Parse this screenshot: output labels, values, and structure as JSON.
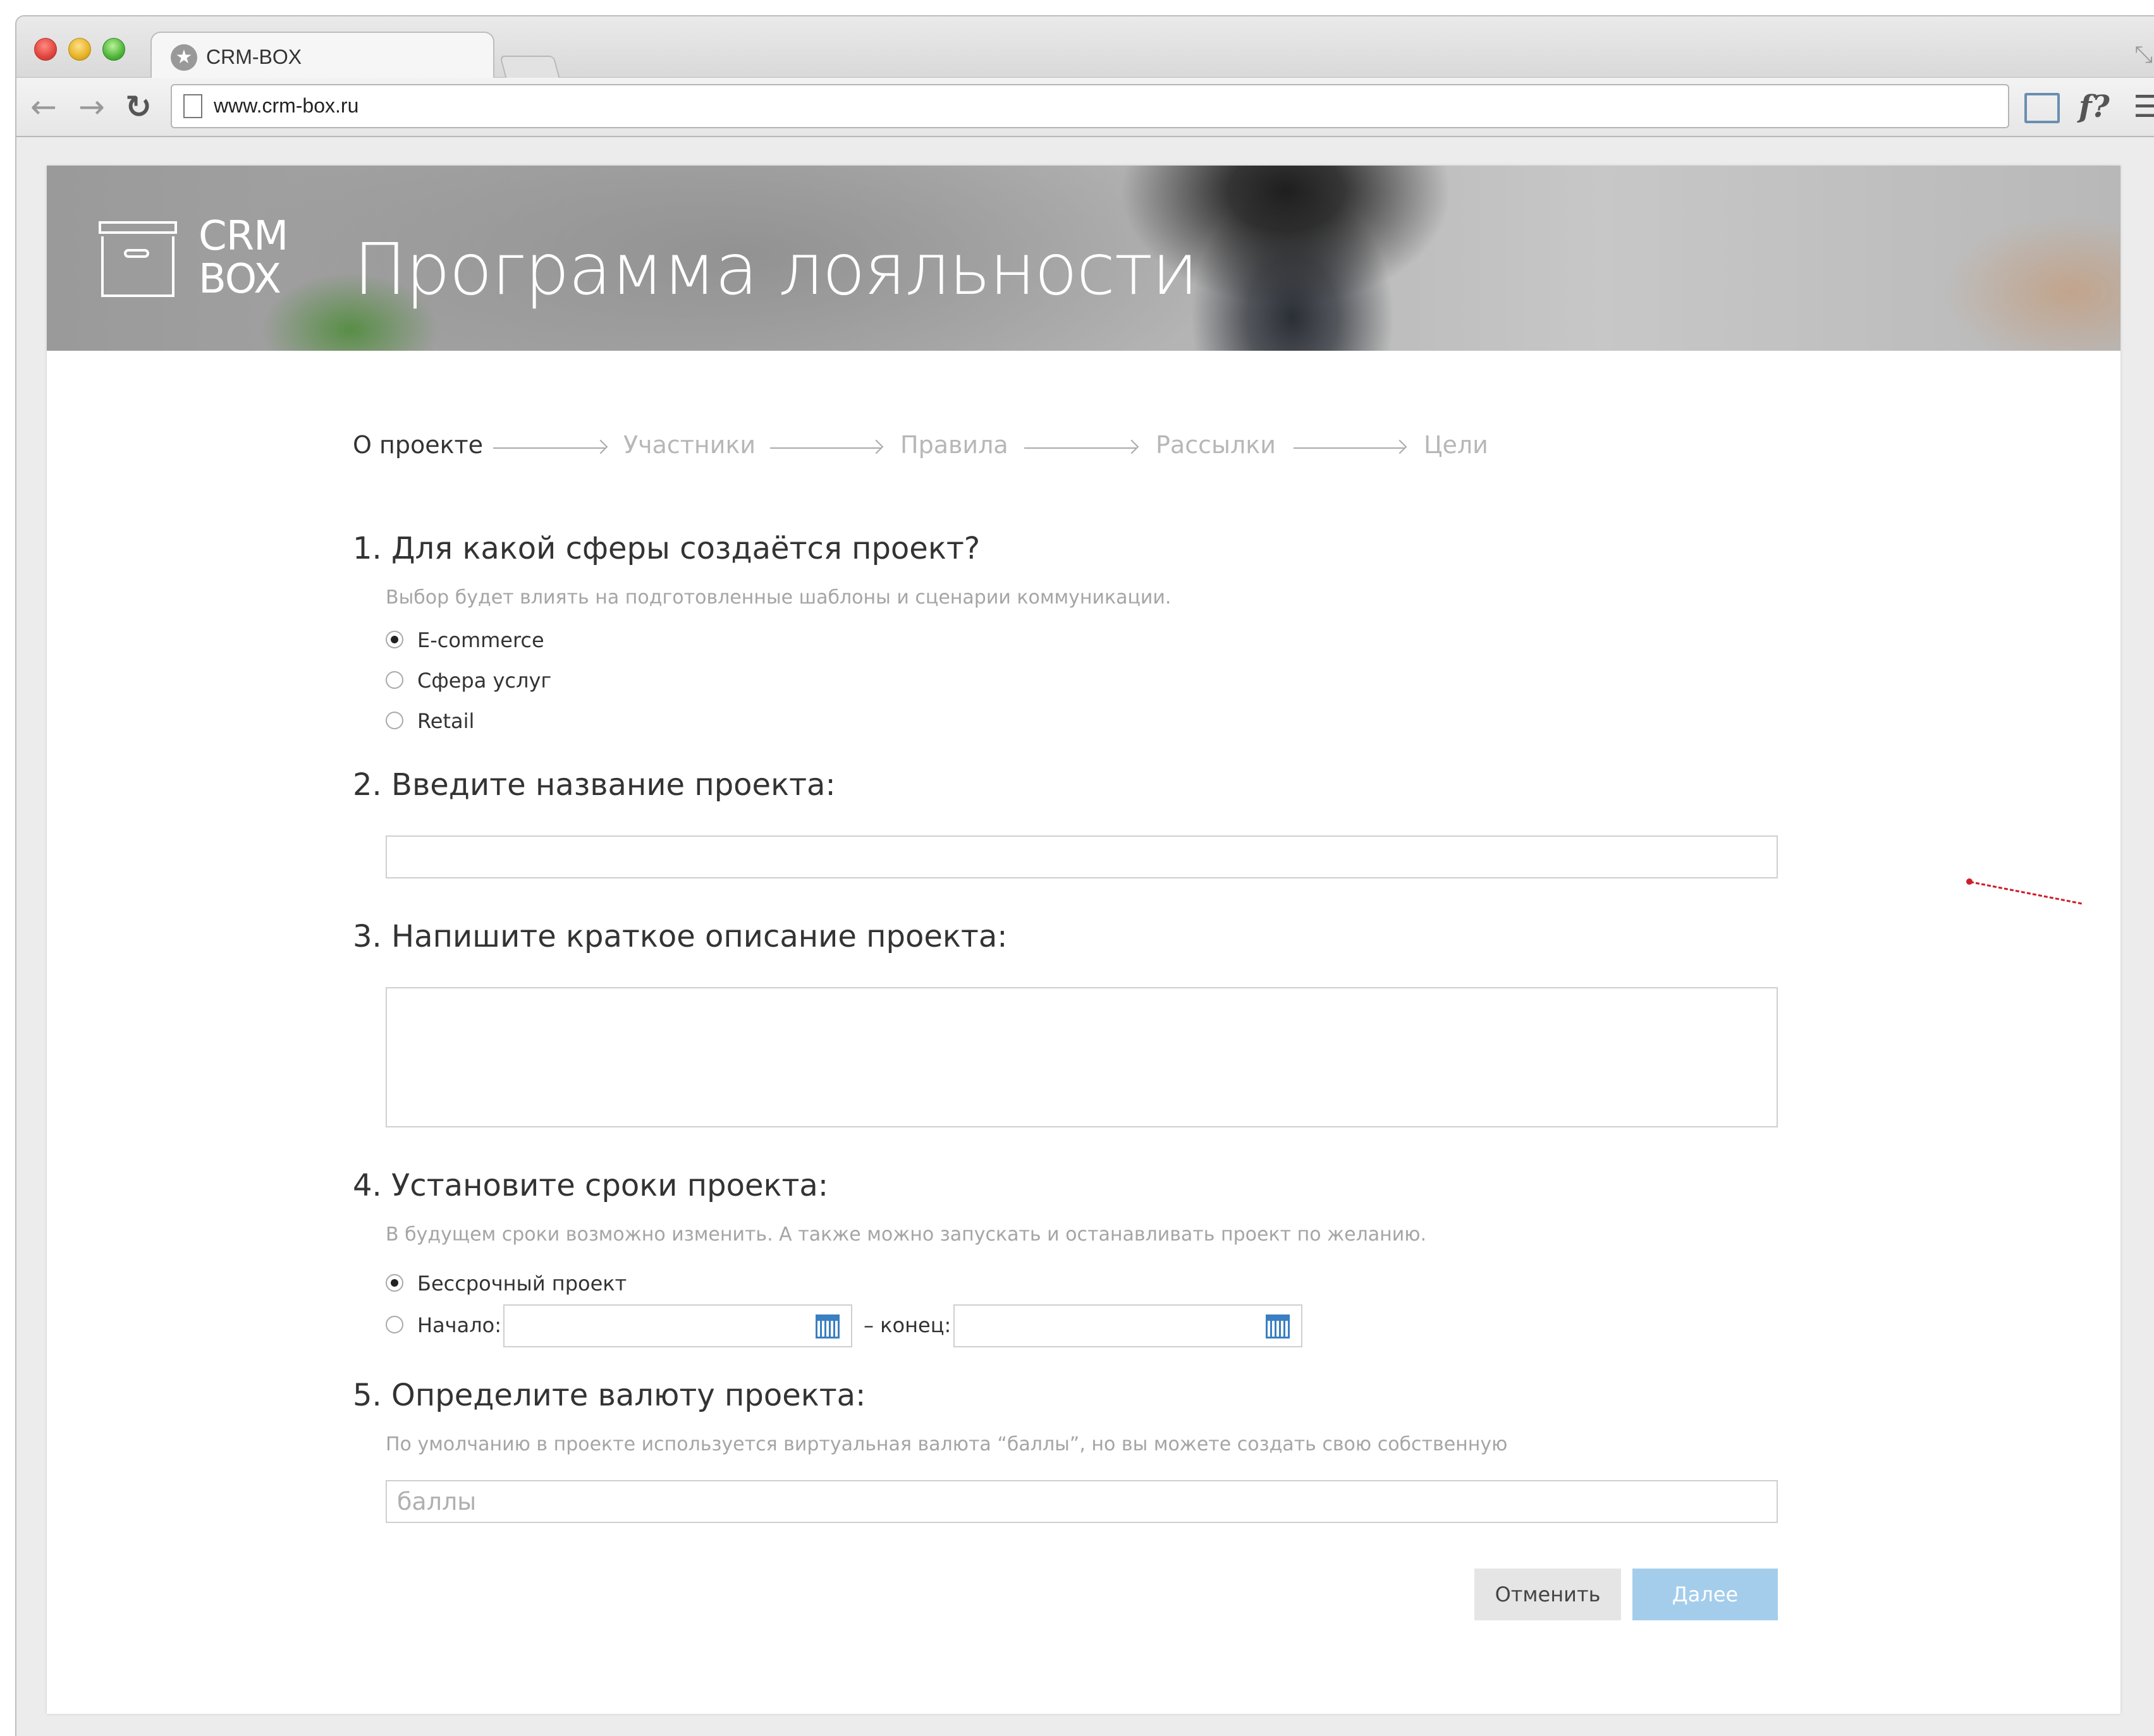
{
  "browser": {
    "tab_title": "CRM-BOX",
    "url": "www.crm-box.ru",
    "toolbar_icons": [
      "back-arrow-icon",
      "forward-arrow-icon",
      "reload-icon",
      "page-icon",
      "frame-icon",
      "font-fx-icon",
      "menu-icon"
    ]
  },
  "header": {
    "logo_line1": "CRM",
    "logo_line2": "BOX",
    "title": "Программа лояльности"
  },
  "steps": [
    {
      "label": "О проекте",
      "active": true
    },
    {
      "label": "Участники",
      "active": false
    },
    {
      "label": "Правила",
      "active": false
    },
    {
      "label": "Рассылки",
      "active": false
    },
    {
      "label": "Цели",
      "active": false
    }
  ],
  "q1": {
    "title": "1. Для какой сферы создаётся проект?",
    "hint": "Выбор будет влиять на подготовленные шаблоны и сценарии коммуникации.",
    "options": [
      {
        "label": "E-commerce",
        "checked": true
      },
      {
        "label": "Сфера услуг",
        "checked": false
      },
      {
        "label": "Retail",
        "checked": false
      }
    ]
  },
  "q2": {
    "title": "2. Введите название проекта:",
    "value": ""
  },
  "q3": {
    "title": "3. Напишите краткое описание проекта:",
    "value": ""
  },
  "q4": {
    "title": "4. Установите сроки проекта:",
    "hint": "В будущем сроки возможно изменить. А также можно запускать и останавливать проект по желанию.",
    "option_unlimited": "Бессрочный проект",
    "unlimited_checked": true,
    "option_start": "Начало:",
    "end_label": "– конец:"
  },
  "q5": {
    "title": "5. Определите валюту проекта:",
    "hint": "По умолчанию в проекте используется виртуальная валюта “баллы”, но вы можете создать свою собственную",
    "placeholder": "баллы"
  },
  "buttons": {
    "cancel": "Отменить",
    "next": "Далее"
  },
  "colors": {
    "accent": "#a4cdec",
    "annotation": "#cc1f2a",
    "calendar": "#3a7fc1"
  }
}
